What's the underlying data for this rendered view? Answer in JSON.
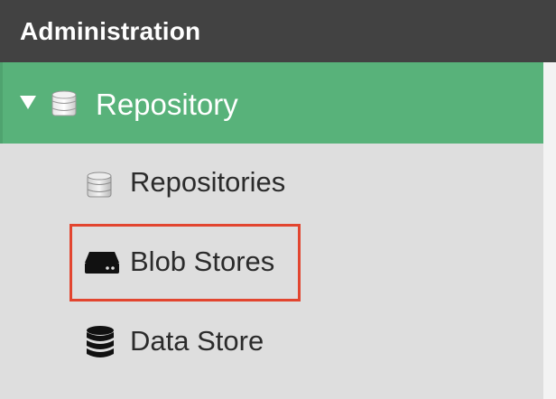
{
  "header": {
    "title": "Administration"
  },
  "group": {
    "label": "Repository",
    "expanded": true,
    "icon": "database-cylinder-icon"
  },
  "items": [
    {
      "label": "Repositories",
      "icon": "database-cylinder-icon"
    },
    {
      "label": "Blob Stores",
      "icon": "hard-drive-icon",
      "highlighted": true
    },
    {
      "label": "Data Store",
      "icon": "database-icon"
    }
  ],
  "colors": {
    "header_bg": "#424242",
    "group_bg": "#58b27a",
    "panel_bg": "#dedede",
    "highlight_border": "#e2452f"
  }
}
